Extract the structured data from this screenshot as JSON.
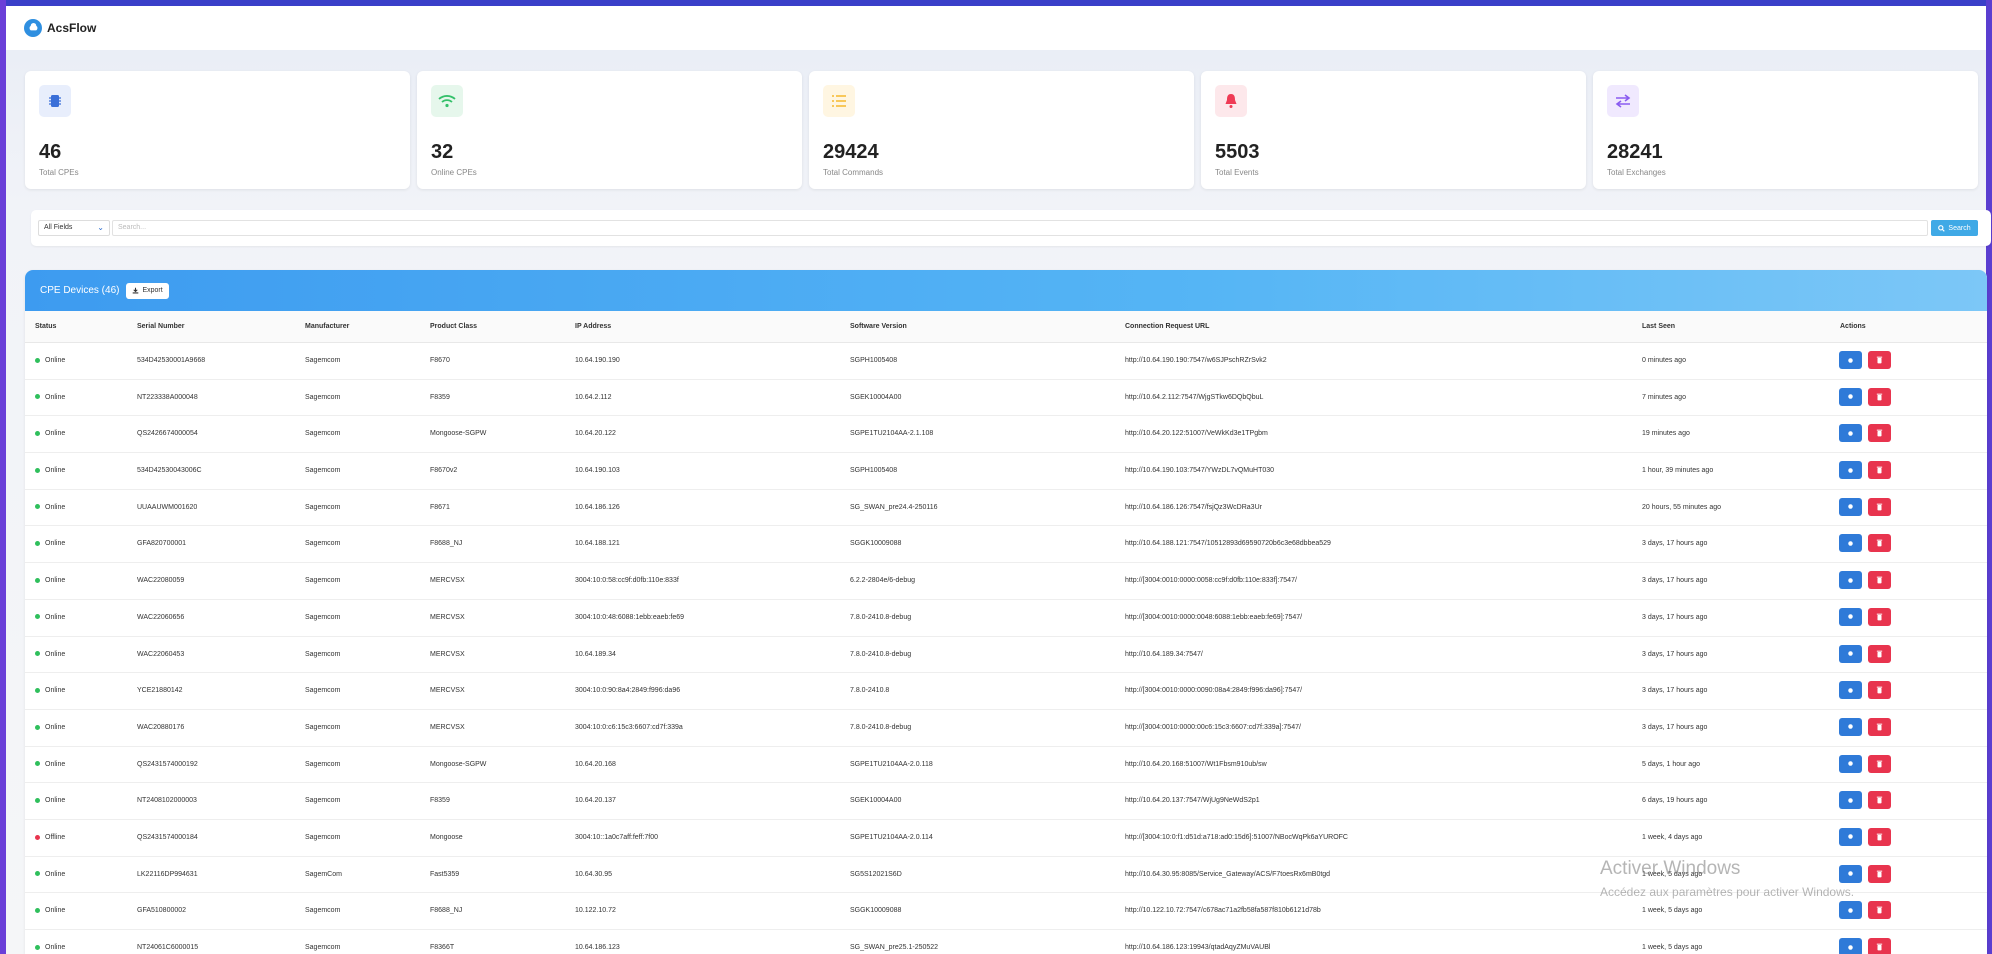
{
  "app": {
    "name": "AcsFlow"
  },
  "stats": [
    {
      "value": "46",
      "label": "Total CPEs",
      "icon": "chip-icon",
      "color": "#3a6fd8",
      "bg": "#e8eefc"
    },
    {
      "value": "32",
      "label": "Online CPEs",
      "icon": "wifi-icon",
      "color": "#34c06a",
      "bg": "#e6f7ec"
    },
    {
      "value": "29424",
      "label": "Total Commands",
      "icon": "list-icon",
      "color": "#f5b82e",
      "bg": "#fff6e2"
    },
    {
      "value": "5503",
      "label": "Total Events",
      "icon": "bell-icon",
      "color": "#ef3b55",
      "bg": "#fde8eb"
    },
    {
      "value": "28241",
      "label": "Total Exchanges",
      "icon": "exchange-icon",
      "color": "#8a5cf0",
      "bg": "#f0e9fe"
    }
  ],
  "search": {
    "field": "All Fields",
    "placeholder": "Search...",
    "button": "Search"
  },
  "table": {
    "title": "CPE Devices (46)",
    "export_label": "Export",
    "columns": [
      "Status",
      "Serial Number",
      "Manufacturer",
      "Product Class",
      "IP Address",
      "Software Version",
      "Connection Request URL",
      "Last Seen",
      "Actions"
    ],
    "rows": [
      {
        "status": "Online",
        "serial": "534D42530001A9668",
        "manufacturer": "Sagemcom",
        "product": "F8670",
        "ip": "10.64.190.190",
        "software": "SGPH1005408",
        "url": "http://10.64.190.190:7547/w6SJPschRZrSvk2",
        "last_seen": "0 minutes ago"
      },
      {
        "status": "Online",
        "serial": "NT223338A000048",
        "manufacturer": "Sagemcom",
        "product": "F8359",
        "ip": "10.64.2.112",
        "software": "SGEK10004A00",
        "url": "http://10.64.2.112:7547/WjgSTkw6DQbQbuL",
        "last_seen": "7 minutes ago"
      },
      {
        "status": "Online",
        "serial": "QS2426674000054",
        "manufacturer": "Sagemcom",
        "product": "Mongoose-SGPW",
        "ip": "10.64.20.122",
        "software": "SGPE1TU2104AA-2.1.108",
        "url": "http://10.64.20.122:51007/VeWkKd3e1TPgbm",
        "last_seen": "19 minutes ago"
      },
      {
        "status": "Online",
        "serial": "534D42530043006C",
        "manufacturer": "Sagemcom",
        "product": "F8670v2",
        "ip": "10.64.190.103",
        "software": "SGPH1005408",
        "url": "http://10.64.190.103:7547/YWzDL7vQMuHT030",
        "last_seen": "1 hour, 39 minutes ago"
      },
      {
        "status": "Online",
        "serial": "UUAAUWM001620",
        "manufacturer": "Sagemcom",
        "product": "F8671",
        "ip": "10.64.186.126",
        "software": "SG_SWAN_pre24.4-250116",
        "url": "http://10.64.186.126:7547/fsjQz3WcDRa3Ur",
        "last_seen": "20 hours, 55 minutes ago"
      },
      {
        "status": "Online",
        "serial": "GFA820700001",
        "manufacturer": "Sagemcom",
        "product": "F8688_NJ",
        "ip": "10.64.188.121",
        "software": "SGGK10009088",
        "url": "http://10.64.188.121:7547/10512893d69590720b6c3e68dbbea529",
        "last_seen": "3 days, 17 hours ago"
      },
      {
        "status": "Online",
        "serial": "WAC22080059",
        "manufacturer": "Sagemcom",
        "product": "MERCVSX",
        "ip": "3004:10:0:58:cc9f:d0fb:110e:833f",
        "software": "6.2.2-2804e/6-debug",
        "url": "http://[3004:0010:0000:0058:cc9f:d0fb:110e:833f]:7547/",
        "last_seen": "3 days, 17 hours ago"
      },
      {
        "status": "Online",
        "serial": "WAC22060656",
        "manufacturer": "Sagemcom",
        "product": "MERCVSX",
        "ip": "3004:10:0:48:6088:1ebb:eaeb:fe69",
        "software": "7.8.0-2410.8-debug",
        "url": "http://[3004:0010:0000:0048:6088:1ebb:eaeb:fe69]:7547/",
        "last_seen": "3 days, 17 hours ago"
      },
      {
        "status": "Online",
        "serial": "WAC22060453",
        "manufacturer": "Sagemcom",
        "product": "MERCVSX",
        "ip": "10.64.189.34",
        "software": "7.8.0-2410.8-debug",
        "url": "http://10.64.189.34:7547/",
        "last_seen": "3 days, 17 hours ago"
      },
      {
        "status": "Online",
        "serial": "YCE21880142",
        "manufacturer": "Sagemcom",
        "product": "MERCVSX",
        "ip": "3004:10:0:90:8a4:2849:f996:da96",
        "software": "7.8.0-2410.8",
        "url": "http://[3004:0010:0000:0090:08a4:2849:f996:da96]:7547/",
        "last_seen": "3 days, 17 hours ago"
      },
      {
        "status": "Online",
        "serial": "WAC20880176",
        "manufacturer": "Sagemcom",
        "product": "MERCVSX",
        "ip": "3004:10:0:c6:15c3:6607:cd7f:339a",
        "software": "7.8.0-2410.8-debug",
        "url": "http://[3004:0010:0000:00c6:15c3:6607:cd7f:339a]:7547/",
        "last_seen": "3 days, 17 hours ago"
      },
      {
        "status": "Online",
        "serial": "QS2431574000192",
        "manufacturer": "Sagemcom",
        "product": "Mongoose-SGPW",
        "ip": "10.64.20.168",
        "software": "SGPE1TU2104AA-2.0.118",
        "url": "http://10.64.20.168:51007/Wt1Fbsm910ub/sw",
        "last_seen": "5 days, 1 hour ago"
      },
      {
        "status": "Online",
        "serial": "NT2408102000003",
        "manufacturer": "Sagemcom",
        "product": "F8359",
        "ip": "10.64.20.137",
        "software": "SGEK10004A00",
        "url": "http://10.64.20.137:7547/WjUg9NeWdS2p1",
        "last_seen": "6 days, 19 hours ago"
      },
      {
        "status": "Offline",
        "serial": "QS2431574000184",
        "manufacturer": "Sagemcom",
        "product": "Mongoose",
        "ip": "3004:10::1a0c7aff:feff:7f00",
        "software": "SGPE1TU2104AA-2.0.114",
        "url": "http://[3004:10:0:f1:d51d:a718:ad0:15d6]:51007/NBocWqPk6aYUROFC",
        "last_seen": "1 week, 4 days ago"
      },
      {
        "status": "Online",
        "serial": "LK22116DP994631",
        "manufacturer": "SagemCom",
        "product": "Fast5359",
        "ip": "10.64.30.95",
        "software": "SG5S12021S6D",
        "url": "http://10.64.30.95:8085/Service_Gateway/ACS/F7toesRx6mB0tgd",
        "last_seen": "1 week, 5 days ago"
      },
      {
        "status": "Online",
        "serial": "GFA510800002",
        "manufacturer": "Sagemcom",
        "product": "F8688_NJ",
        "ip": "10.122.10.72",
        "software": "SGGK10009088",
        "url": "http://10.122.10.72:7547/c678ac71a2fb58fa587f810b6121d78b",
        "last_seen": "1 week, 5 days ago"
      },
      {
        "status": "Online",
        "serial": "NT24061C6000015",
        "manufacturer": "Sagemcom",
        "product": "F8366T",
        "ip": "10.64.186.123",
        "software": "SG_SWAN_pre25.1-250522",
        "url": "http://10.64.186.123:19943/qtadAqyZMuVAUBl",
        "last_seen": "1 week, 5 days ago"
      }
    ]
  },
  "watermark": {
    "line1": "Activer Windows",
    "line2": "Accédez aux paramètres pour activer Windows."
  }
}
